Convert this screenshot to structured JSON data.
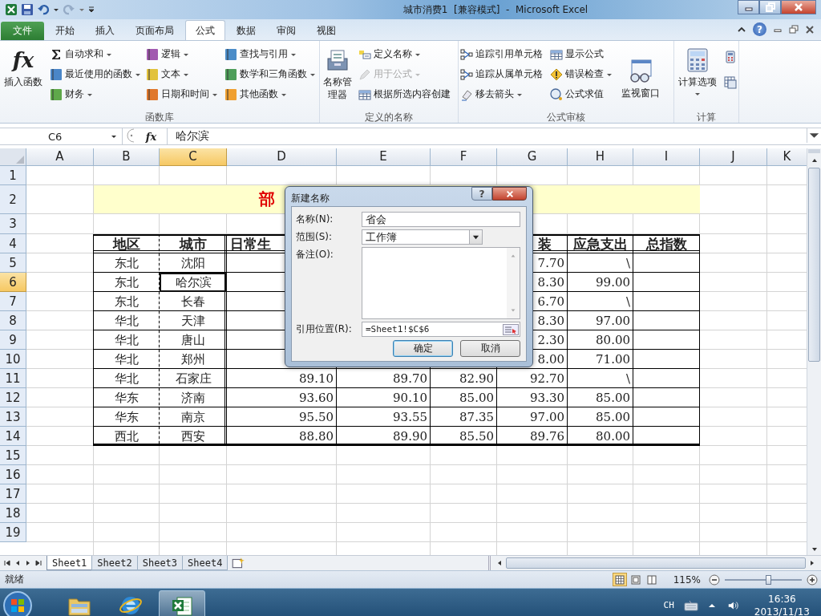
{
  "title_bar": {
    "title": "城市消费1  [兼容模式]  -  Microsoft Excel"
  },
  "ribbon_tabs": [
    {
      "label": "文件",
      "kind": "file",
      "selected": false
    },
    {
      "label": "开始",
      "kind": "tab",
      "selected": false
    },
    {
      "label": "插入",
      "kind": "tab",
      "selected": false
    },
    {
      "label": "页面布局",
      "kind": "tab",
      "selected": false
    },
    {
      "label": "公式",
      "kind": "tab",
      "selected": true
    },
    {
      "label": "数据",
      "kind": "tab",
      "selected": false
    },
    {
      "label": "审阅",
      "kind": "tab",
      "selected": false
    },
    {
      "label": "视图",
      "kind": "tab",
      "selected": false
    }
  ],
  "help": "?",
  "ribbon_groups": [
    {
      "label": "函数库",
      "large_first": [
        {
          "label": "插入函数",
          "glyph": "fx",
          "kind": "glyph",
          "dropdown": false
        }
      ],
      "columns": [
        [
          {
            "label": "自动求和",
            "kind": "sigma",
            "dropdown": true,
            "disabled": false
          },
          {
            "label": "最近使用的函数",
            "kind": "book",
            "color": "#4a86c8",
            "dropdown": true,
            "disabled": false
          },
          {
            "label": "财务",
            "kind": "book",
            "color": "#5fa84a",
            "dropdown": true,
            "disabled": false
          }
        ],
        [
          {
            "label": "逻辑",
            "kind": "book",
            "color": "#a25ab0",
            "dropdown": true,
            "disabled": false
          },
          {
            "label": "文本",
            "kind": "book",
            "color": "#e2c23c",
            "dropdown": true,
            "disabled": false
          },
          {
            "label": "日期和时间",
            "kind": "book",
            "color": "#e0782c",
            "dropdown": true,
            "disabled": false
          }
        ],
        [
          {
            "label": "查找与引用",
            "kind": "book",
            "color": "#4a8cc8",
            "dropdown": true,
            "disabled": false
          },
          {
            "label": "数学和三角函数",
            "kind": "book",
            "color": "#4e9e5a",
            "dropdown": true,
            "disabled": false
          },
          {
            "label": "其他函数",
            "kind": "book",
            "color": "#f0a030",
            "dropdown": true,
            "disabled": false
          }
        ]
      ]
    },
    {
      "label": "定义的名称",
      "large_first": [
        {
          "label": "名称管理器",
          "kind": "cabinet",
          "dropdown": false
        }
      ],
      "columns": [
        [
          {
            "label": "定义名称",
            "kind": "tag",
            "dropdown": true,
            "disabled": false
          },
          {
            "label": "用于公式",
            "kind": "pencil",
            "dropdown": true,
            "disabled": true
          },
          {
            "label": "根据所选内容创建",
            "kind": "table",
            "dropdown": false,
            "disabled": false
          }
        ]
      ]
    },
    {
      "label": "公式审核",
      "columns": [
        [
          {
            "label": "追踪引用单元格",
            "kind": "trace",
            "dropdown": false,
            "disabled": false
          },
          {
            "label": "追踪从属单元格",
            "kind": "trace",
            "dropdown": false,
            "disabled": false
          },
          {
            "label": "移去箭头",
            "kind": "eraser",
            "dropdown": true,
            "disabled": false
          }
        ],
        [
          {
            "label": "显示公式",
            "kind": "table",
            "dropdown": false,
            "disabled": false
          },
          {
            "label": "错误检查",
            "kind": "warning",
            "dropdown": true,
            "disabled": false
          },
          {
            "label": "公式求值",
            "kind": "magnifier",
            "dropdown": false,
            "disabled": false
          }
        ]
      ],
      "large_last": [
        {
          "label": "监视窗口",
          "kind": "glasses",
          "dropdown": false
        }
      ]
    },
    {
      "label": "计算",
      "large_first": [
        {
          "label": "计算选项",
          "kind": "calculator",
          "dropdown": true
        }
      ],
      "small_icons": [
        {
          "kind": "calculator"
        },
        {
          "kind": "table"
        }
      ]
    }
  ],
  "formula_bar": {
    "name_box": "C6",
    "fx": "fx",
    "value": "哈尔滨"
  },
  "columns": [
    {
      "label": "A",
      "selected": false
    },
    {
      "label": "B",
      "selected": false
    },
    {
      "label": "C",
      "selected": true
    },
    {
      "label": "D",
      "selected": false
    },
    {
      "label": "E",
      "selected": false
    },
    {
      "label": "F",
      "selected": false
    },
    {
      "label": "G",
      "selected": false
    },
    {
      "label": "H",
      "selected": false
    },
    {
      "label": "I",
      "selected": false
    },
    {
      "label": "J",
      "selected": false
    },
    {
      "label": "K",
      "selected": false
    }
  ],
  "rows": [
    {
      "number": "1",
      "selected": false,
      "kind": "blank"
    },
    {
      "number": "2",
      "selected": false,
      "kind": "banner",
      "banner": "部"
    },
    {
      "number": "3",
      "selected": false,
      "kind": "blank"
    },
    {
      "number": "4",
      "selected": false,
      "kind": "header",
      "cells": {
        "b": "地区",
        "c": "城市",
        "d": "日常生",
        "g": "装",
        "h": "应急支出",
        "i": "总指数"
      }
    },
    {
      "number": "5",
      "selected": false,
      "kind": "data",
      "cells": {
        "b": "东北",
        "c": "沈阳",
        "g": "7.70",
        "h": "\\"
      }
    },
    {
      "number": "6",
      "selected": true,
      "kind": "data",
      "cells": {
        "b": "东北",
        "c": "哈尔滨",
        "g": "8.30",
        "h": "99.00"
      }
    },
    {
      "number": "7",
      "selected": false,
      "kind": "data",
      "cells": {
        "b": "东北",
        "c": "长春",
        "g": "6.70",
        "h": "\\"
      }
    },
    {
      "number": "8",
      "selected": false,
      "kind": "data",
      "cells": {
        "b": "华北",
        "c": "天津",
        "g": "8.30",
        "h": "97.00"
      }
    },
    {
      "number": "9",
      "selected": false,
      "kind": "data",
      "cells": {
        "b": "华北",
        "c": "唐山",
        "g": "2.30",
        "h": "80.00"
      }
    },
    {
      "number": "10",
      "selected": false,
      "kind": "data",
      "cells": {
        "b": "华北",
        "c": "郑州",
        "g": "8.00",
        "h": "71.00"
      }
    },
    {
      "number": "11",
      "selected": false,
      "kind": "data",
      "cells": {
        "b": "华北",
        "c": "石家庄",
        "d": "89.10",
        "e": "89.70",
        "f": "82.90",
        "g": "92.70",
        "h": "\\"
      }
    },
    {
      "number": "12",
      "selected": false,
      "kind": "data",
      "cells": {
        "b": "华东",
        "c": "济南",
        "d": "93.60",
        "e": "90.10",
        "f": "85.00",
        "g": "93.30",
        "h": "85.00"
      }
    },
    {
      "number": "13",
      "selected": false,
      "kind": "data",
      "cells": {
        "b": "华东",
        "c": "南京",
        "d": "95.50",
        "e": "93.55",
        "f": "87.35",
        "g": "97.00",
        "h": "85.00"
      }
    },
    {
      "number": "14",
      "selected": false,
      "kind": "data",
      "cells": {
        "b": "西北",
        "c": "西安",
        "d": "88.80",
        "e": "89.90",
        "f": "85.50",
        "g": "89.76",
        "h": "80.00"
      }
    },
    {
      "number": "15",
      "selected": false,
      "kind": "blank"
    },
    {
      "number": "16",
      "selected": false,
      "kind": "blank"
    },
    {
      "number": "17",
      "selected": false,
      "kind": "blank"
    },
    {
      "number": "18",
      "selected": false,
      "kind": "blank"
    },
    {
      "number": "19",
      "selected": false,
      "kind": "blank"
    }
  ],
  "sheet_tabs": [
    {
      "label": "Sheet1",
      "selected": true
    },
    {
      "label": "Sheet2",
      "selected": false
    },
    {
      "label": "Sheet3",
      "selected": false
    },
    {
      "label": "Sheet4",
      "selected": false
    }
  ],
  "status_bar": {
    "status": "就绪",
    "views": [
      {
        "kind": "normal",
        "selected": true
      },
      {
        "kind": "layout",
        "selected": false
      },
      {
        "kind": "pagebreak",
        "selected": false
      }
    ],
    "zoom": "115%",
    "level": 0.56
  },
  "dialog": {
    "title": "新建名称",
    "help": "?",
    "fields": [
      {
        "label": "名称(N):",
        "kind": "text",
        "value": "省会"
      },
      {
        "label": "范围(S):",
        "kind": "select",
        "value": "工作簿"
      },
      {
        "label": "备注(O):",
        "kind": "textarea"
      },
      {
        "label": "引用位置(R):",
        "kind": "ref",
        "value": "=Sheet1!$C$6"
      }
    ],
    "buttons": [
      {
        "label": "确定",
        "default": true
      },
      {
        "label": "取消",
        "default": false
      }
    ]
  },
  "taskbar": {
    "apps": [
      {
        "kind": "folder",
        "selected": false
      },
      {
        "kind": "browser",
        "selected": false
      },
      {
        "kind": "excel",
        "selected": true
      }
    ],
    "language": "CH",
    "time": "16:36",
    "date": "2013/11/13"
  }
}
